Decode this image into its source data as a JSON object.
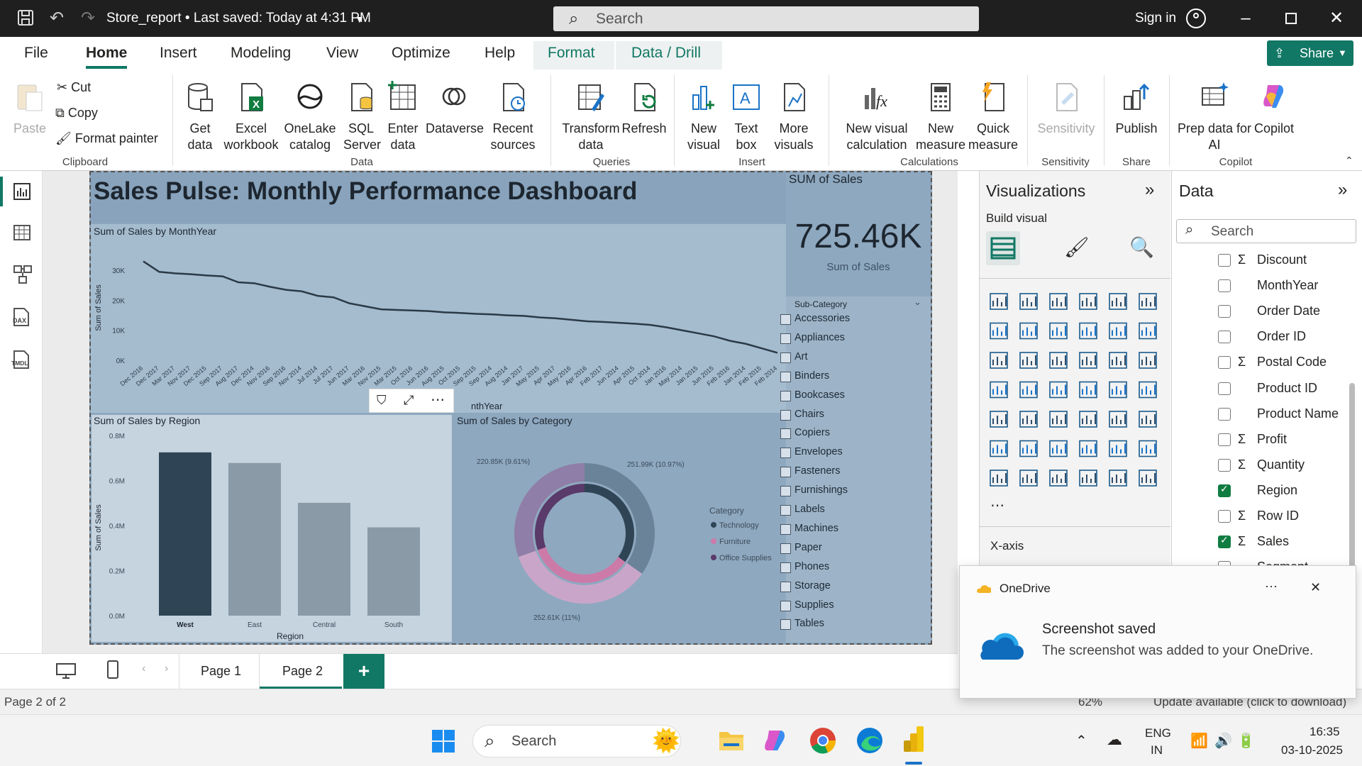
{
  "titlebar": {
    "file_title": "Store_report • Last saved: Today at 4:31 PM",
    "search_placeholder": "Search",
    "sign_in": "Sign in"
  },
  "menu": {
    "items": [
      "File",
      "Home",
      "Insert",
      "Modeling",
      "View",
      "Optimize",
      "Help",
      "Format",
      "Data / Drill"
    ],
    "share": "Share"
  },
  "ribbon": {
    "clipboard": {
      "paste": "Paste",
      "cut": "Cut",
      "copy": "Copy",
      "format_painter": "Format painter",
      "group": "Clipboard"
    },
    "data": {
      "get_data": "Get\ndata",
      "excel": "Excel\nworkbook",
      "onelake": "OneLake\ncatalog",
      "sql": "SQL\nServer",
      "enter": "Enter\ndata",
      "dataverse": "Dataverse",
      "recent": "Recent\nsources",
      "group": "Data"
    },
    "queries": {
      "transform": "Transform\ndata",
      "refresh": "Refresh",
      "group": "Queries"
    },
    "insert": {
      "new_visual": "New\nvisual",
      "text_box": "Text\nbox",
      "more_visuals": "More\nvisuals",
      "group": "Insert"
    },
    "calculations": {
      "new_visual_calc": "New visual\ncalculation",
      "new_measure": "New\nmeasure",
      "quick_measure": "Quick\nmeasure",
      "group": "Calculations"
    },
    "sensitivity": {
      "label": "Sensitivity",
      "group": "Sensitivity"
    },
    "share": {
      "publish": "Publish",
      "group": "Share"
    },
    "copilot": {
      "prep": "Prep data for\nAI",
      "copilot": "Copilot",
      "group": "Copilot"
    }
  },
  "report": {
    "title": "Sales Pulse: Monthly Performance Dashboard",
    "kpi": {
      "header": "SUM of Sales",
      "value": "725.46K",
      "caption": "Sum of Sales"
    },
    "line_title": "Sum of Sales by MonthYear",
    "line_ylabel": "Sum of Sales",
    "line_xlabel_partial": "nthYear",
    "bar_title": "Sum of Sales by Region",
    "bar_ylabel": "Sum of Sales",
    "bar_xlabel": "Region",
    "donut_title": "Sum of Sales by Category",
    "donut_legend_title": "Category",
    "slicer_title": "Sub-Category",
    "subcategories": [
      "Accessories",
      "Appliances",
      "Art",
      "Binders",
      "Bookcases",
      "Chairs",
      "Copiers",
      "Envelopes",
      "Fasteners",
      "Furnishings",
      "Labels",
      "Machines",
      "Paper",
      "Phones",
      "Storage",
      "Supplies",
      "Tables"
    ]
  },
  "chart_data": [
    {
      "type": "line",
      "title": "Sum of Sales by MonthYear",
      "ylabel": "Sum of Sales",
      "ylim": [
        0,
        35000
      ],
      "yticks": [
        "0K",
        "10K",
        "20K",
        "30K"
      ],
      "x": [
        "Dec 2016",
        "Dec 2017",
        "Mar 2017",
        "Nov 2017",
        "Dec 2015",
        "Sep 2017",
        "Aug 2017",
        "Dec 2014",
        "Nov 2016",
        "Sep 2016",
        "Nov 2014",
        "Jul 2014",
        "Jul 2017",
        "Jun 2017",
        "Mar 2016",
        "Nov 2015",
        "Mar 2015",
        "Oct 2016",
        "Jun 2016",
        "Aug 2015",
        "Oct 2015",
        "Sep 2015",
        "Sep 2014",
        "Aug 2014",
        "Jan 2017",
        "May 2015",
        "Apr 2017",
        "May 2016",
        "Apr 2016",
        "Feb 2017",
        "Jun 2014",
        "Apr 2015",
        "Oct 2014",
        "Jan 2016",
        "May 2014",
        "Jan 2015",
        "Jun 2015",
        "Feb 2016",
        "Jan 2014",
        "Feb 2015",
        "Feb 2014"
      ],
      "values": [
        33000,
        29500,
        29000,
        28700,
        28300,
        28000,
        26000,
        25700,
        24500,
        23500,
        23000,
        21500,
        21000,
        19000,
        18000,
        17000,
        16800,
        16600,
        16400,
        16000,
        15800,
        15500,
        15300,
        15000,
        14800,
        14300,
        14000,
        13500,
        13000,
        12800,
        12500,
        12200,
        11800,
        11000,
        10000,
        9000,
        8000,
        6500,
        5500,
        4000,
        2500
      ]
    },
    {
      "type": "bar",
      "title": "Sum of Sales by Region",
      "xlabel": "Region",
      "ylabel": "Sum of Sales",
      "ylim": [
        0,
        800000
      ],
      "yticks": [
        "0.0M",
        "0.2M",
        "0.4M",
        "0.6M",
        "0.8M"
      ],
      "categories": [
        "West",
        "East",
        "Central",
        "South"
      ],
      "values": [
        725000,
        678000,
        501000,
        392000
      ]
    },
    {
      "type": "pie",
      "title": "Sum of Sales by Category",
      "legend_title": "Category",
      "series": [
        {
          "name": "Technology",
          "value": 251990,
          "label": "251.99K (10.97%)"
        },
        {
          "name": "Furniture",
          "value": 252610,
          "label": "252.61K (11%)"
        },
        {
          "name": "Office Supplies",
          "value": 220850,
          "label": "220.85K (9.61%)"
        }
      ]
    }
  ],
  "viz": {
    "title": "Visualizations",
    "build": "Build visual",
    "xaxis": "X-axis"
  },
  "datapane": {
    "title": "Data",
    "search": "Search",
    "fields": [
      {
        "name": "Discount",
        "sigma": true,
        "checked": false
      },
      {
        "name": "MonthYear",
        "sigma": false,
        "checked": false
      },
      {
        "name": "Order Date",
        "sigma": false,
        "checked": false
      },
      {
        "name": "Order ID",
        "sigma": false,
        "checked": false
      },
      {
        "name": "Postal Code",
        "sigma": true,
        "checked": false
      },
      {
        "name": "Product ID",
        "sigma": false,
        "checked": false
      },
      {
        "name": "Product Name",
        "sigma": false,
        "checked": false
      },
      {
        "name": "Profit",
        "sigma": true,
        "checked": false
      },
      {
        "name": "Quantity",
        "sigma": true,
        "checked": false
      },
      {
        "name": "Region",
        "sigma": false,
        "checked": true
      },
      {
        "name": "Row ID",
        "sigma": true,
        "checked": false
      },
      {
        "name": "Sales",
        "sigma": true,
        "checked": true
      },
      {
        "name": "Segment",
        "sigma": false,
        "checked": false
      }
    ]
  },
  "pages": {
    "page1": "Page 1",
    "page2": "Page 2",
    "add": "+"
  },
  "status": {
    "page": "Page 2 of 2",
    "zoom": "62%",
    "update": "Update available (click to download)"
  },
  "toast": {
    "app": "OneDrive",
    "title": "Screenshot saved",
    "body": "The screenshot was added to your OneDrive.",
    "more": "···"
  },
  "taskbar": {
    "search": "Search",
    "lang1": "ENG",
    "lang2": "IN",
    "time": "16:35",
    "date": "03-10-2025"
  },
  "colors": {
    "accent": "#117865",
    "report_bg": "#8ea8bf",
    "dark_bar": "#2f4454"
  }
}
